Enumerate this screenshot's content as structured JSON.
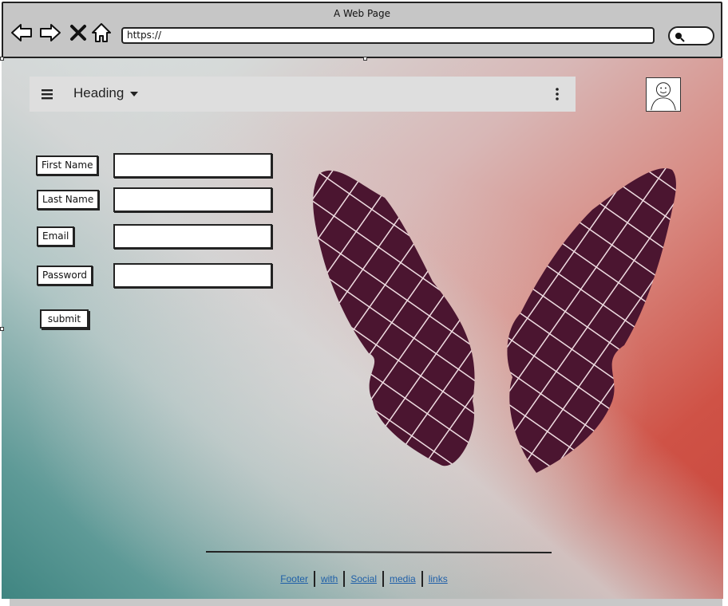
{
  "window": {
    "title": "A Web Page",
    "url": "https://"
  },
  "nav": {
    "back_icon": "back-arrow-icon",
    "forward_icon": "forward-arrow-icon",
    "close_icon": "close-icon",
    "home_icon": "home-icon",
    "search_icon": "search-icon"
  },
  "appbar": {
    "menu_icon": "hamburger-icon",
    "heading": "Heading",
    "caret_icon": "caret-down-icon",
    "more_icon": "kebab-icon"
  },
  "avatar_icon": "user-avatar-icon",
  "form": {
    "fields": [
      {
        "label": "First Name",
        "value": ""
      },
      {
        "label": "Last Name",
        "value": ""
      },
      {
        "label": "Email",
        "value": ""
      },
      {
        "label": "Password",
        "value": ""
      }
    ],
    "submit_label": "submit"
  },
  "hero_image": "butterfly-wings-image",
  "footer": {
    "links": [
      "Footer",
      "with",
      "Social",
      "media",
      "links"
    ]
  },
  "colors": {
    "link": "#1f5fa8",
    "butterfly": "#4b1530",
    "appbar": "#dedede"
  }
}
